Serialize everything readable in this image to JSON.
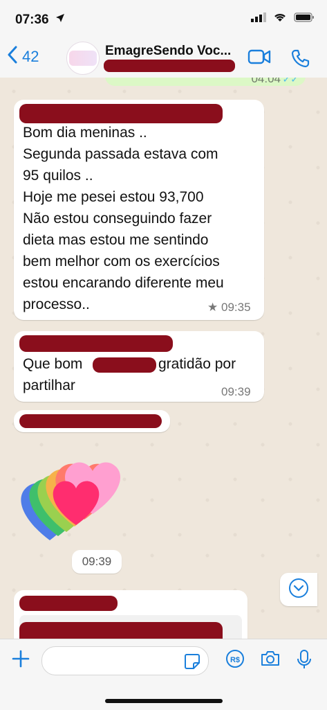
{
  "status_bar": {
    "time": "07:36"
  },
  "header": {
    "back_count": "42",
    "chat_title": "EmagreSendo Voc..."
  },
  "messages": {
    "outgoing_partial_time": "04:04",
    "m1": {
      "text": "Bom dia meninas ..\nSegunda passada estava com\n95 quilos ..\nHoje me pesei estou 93,700\nNão estou conseguindo fazer\ndieta mas estou me sentindo\nbem melhor com os exercícios\nestou encarando diferente meu\nprocesso..",
      "time": "09:35",
      "starred": true
    },
    "m2": {
      "text_part1": "Que bom",
      "text_part2": "gratidão por",
      "text_part3": "partilhar",
      "time": "09:39"
    },
    "emoji_time": "09:39"
  },
  "input": {
    "placeholder": ""
  },
  "colors": {
    "accent": "#1a7fdc",
    "outgoing_bubble": "#dcf8c6",
    "incoming_bubble": "#ffffff",
    "chat_bg": "#efe7dc",
    "redaction": "#8a0e1c"
  },
  "icons": [
    "location-arrow-icon",
    "signal-icon",
    "wifi-icon",
    "battery-icon",
    "chevron-left-icon",
    "video-call-icon",
    "phone-icon",
    "double-check-icon",
    "star-icon",
    "chevron-down-circle-icon",
    "plus-icon",
    "sticker-icon",
    "pix-payment-icon",
    "camera-icon",
    "microphone-icon"
  ]
}
